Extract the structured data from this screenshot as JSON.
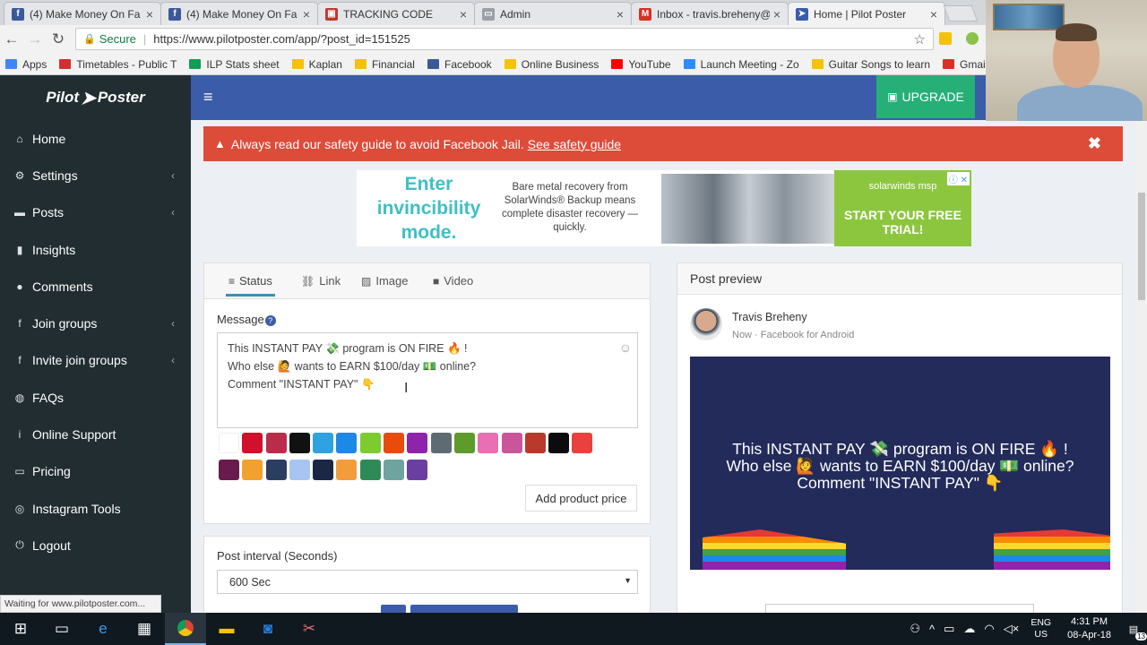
{
  "browser": {
    "tabs": [
      {
        "title": "(4) Make Money On Fa",
        "icon": "facebook-icon",
        "color": "#3b5998",
        "glyph": "f"
      },
      {
        "title": "(4) Make Money On Fa",
        "icon": "facebook-icon",
        "color": "#3b5998",
        "glyph": "f"
      },
      {
        "title": "TRACKING CODE",
        "icon": "tracking-icon",
        "color": "#c0392b",
        "glyph": "▣"
      },
      {
        "title": "Admin",
        "icon": "page-icon",
        "color": "#9aa0a6",
        "glyph": "▭"
      },
      {
        "title": "Inbox - travis.breheny@",
        "icon": "gmail-icon",
        "color": "#d93025",
        "glyph": "M"
      },
      {
        "title": "Home | Pilot Poster",
        "icon": "pilot-poster-icon",
        "color": "#3b5ca8",
        "glyph": "➤"
      }
    ],
    "secure_label": "Secure",
    "url": "https://www.pilotposter.com/app/?post_id=151525",
    "bookmarks": [
      {
        "label": "Apps",
        "color": "#4285f4"
      },
      {
        "label": "Timetables - Public T",
        "color": "#d32f2f"
      },
      {
        "label": "ILP Stats sheet",
        "color": "#0f9d58"
      },
      {
        "label": "Kaplan",
        "color": "#f4c20d"
      },
      {
        "label": "Financial",
        "color": "#f4c20d"
      },
      {
        "label": "Facebook",
        "color": "#3b5998"
      },
      {
        "label": "Online Business",
        "color": "#f4c20d"
      },
      {
        "label": "YouTube",
        "color": "#ff0000"
      },
      {
        "label": "Launch Meeting - Zo",
        "color": "#2d8cff"
      },
      {
        "label": "Guitar Songs to learn",
        "color": "#f4c20d"
      },
      {
        "label": "Gmail - Trav",
        "color": "#d93025"
      }
    ],
    "status_text": "Waiting for www.pilotposter.com..."
  },
  "app": {
    "logo": {
      "left": "Pilot",
      "right": "Poster"
    },
    "upgrade_label": "UPGRADE",
    "nav": [
      {
        "label": "Home",
        "icon": "home-icon",
        "glyph": "⌂",
        "chev": false
      },
      {
        "label": "Settings",
        "icon": "gear-icon",
        "glyph": "⚙",
        "chev": true
      },
      {
        "label": "Posts",
        "icon": "folder-icon",
        "glyph": "▬",
        "chev": true
      },
      {
        "label": "Insights",
        "icon": "chart-icon",
        "glyph": "▮",
        "chev": false
      },
      {
        "label": "Comments",
        "icon": "comment-icon",
        "glyph": "●",
        "chev": false
      },
      {
        "label": "Join groups",
        "icon": "facebook-square-icon",
        "glyph": "f",
        "chev": true
      },
      {
        "label": "Invite join groups",
        "icon": "facebook-square-icon",
        "glyph": "f",
        "chev": true
      },
      {
        "label": "FAQs",
        "icon": "globe-icon",
        "glyph": "◍",
        "chev": false
      },
      {
        "label": "Online Support",
        "icon": "info-icon",
        "glyph": "i",
        "chev": false
      },
      {
        "label": "Pricing",
        "icon": "money-icon",
        "glyph": "▭",
        "chev": false
      },
      {
        "label": "Instagram Tools",
        "icon": "instagram-icon",
        "glyph": "◎",
        "chev": false
      },
      {
        "label": "Logout",
        "icon": "logout-icon",
        "glyph": "⏻",
        "chev": false
      }
    ],
    "alert": {
      "text": "Always read our safety guide to avoid Facebook Jail.",
      "link": "See safety guide"
    },
    "ad": {
      "headline": "Enter invincibility mode.",
      "body": "Bare metal recovery from SolarWinds® Backup means complete disaster recovery — quickly.",
      "brand": "solarwinds msp",
      "cta": "START YOUR FREE TRIAL!"
    },
    "composer": {
      "tabs": [
        {
          "label": "Status",
          "icon": "bars-icon",
          "glyph": "≡"
        },
        {
          "label": "Link",
          "icon": "link-icon",
          "glyph": "⛓"
        },
        {
          "label": "Image",
          "icon": "image-icon",
          "glyph": "▨"
        },
        {
          "label": "Video",
          "icon": "video-icon",
          "glyph": "■"
        }
      ],
      "message_label": "Message",
      "message_lines": [
        "This INSTANT PAY 💸 program is ON FIRE 🔥 !",
        "Who else 🙋 wants to EARN $100/day 💵 online?",
        "Comment \"INSTANT PAY\" 👇"
      ],
      "swatches": [
        "#ffffff",
        "#d0112b",
        "#b82e4a",
        "#111111",
        "#2ea3e0",
        "#1e88e5",
        "#7ccb2f",
        "#e74c0c",
        "#8e24aa",
        "#5f6b72",
        "#5d9b2a",
        "#e86fb3",
        "#c9569a",
        "#b83a2a",
        "#0c0c0c",
        "#e8413e",
        "#6a1b4d",
        "#f0a130",
        "#2c3e60",
        "#a8c4f0",
        "#1a2745",
        "#f39c3c",
        "#2e8b57",
        "#6fa3a0",
        "#6a3fa0"
      ],
      "add_price_label": "Add product price",
      "interval_label": "Post interval (Seconds)",
      "interval_value": "600 Sec"
    },
    "preview": {
      "title": "Post preview",
      "author": "Travis Breheny",
      "meta": "Now · Facebook for Android",
      "lines": [
        "This INSTANT PAY 💸 program is ON FIRE 🔥 !",
        "Who else 🙋 wants to EARN $100/day 💵 online?",
        "Comment \"INSTANT PAY\" 👇"
      ]
    }
  },
  "taskbar": {
    "lang": [
      "ENG",
      "US"
    ],
    "time": "4:31 PM",
    "date": "08-Apr-18",
    "notifications": "13"
  }
}
